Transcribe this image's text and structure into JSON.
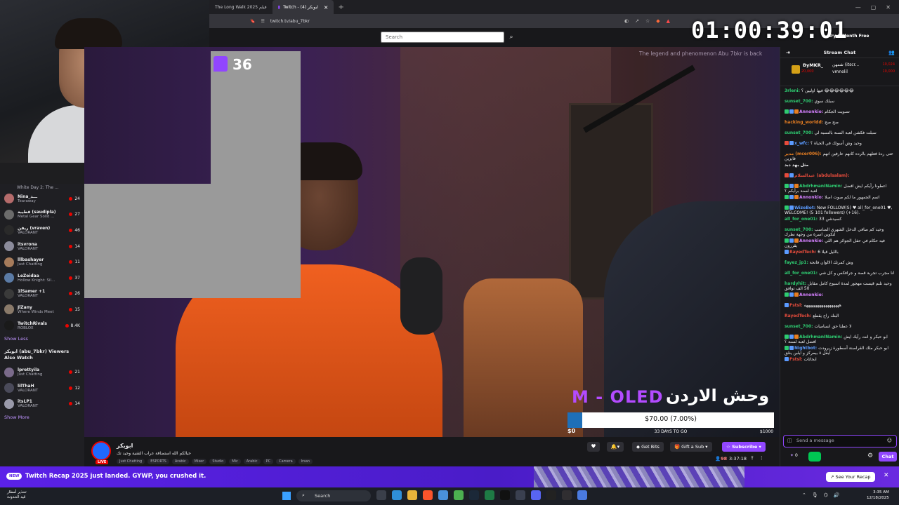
{
  "browser": {
    "tabs": [
      {
        "label": "The Long Walk 2025 فيلم",
        "active": false
      },
      {
        "label": "Twitch - ابوبكر (4)",
        "active": true
      }
    ],
    "url": "twitch.tv/abu_7bkr"
  },
  "topnav": {
    "search_placeholder": "Search",
    "try_turbo": "Try 1-Month Free"
  },
  "overlay": {
    "clock": "01:00:39:01",
    "bits_count": "36",
    "video_caption": "The legend and phenomenon Abu 7bkr is back",
    "oled_text": "M - OLED",
    "arabic_title": "وحش الاردن",
    "goal": {
      "amount": "$70.00 (7.00%)",
      "fraction": 0.07,
      "days": "33 DAYS TO GO",
      "min": "$0",
      "max": "$1000"
    }
  },
  "sidebar": {
    "partial_item": "White Day 2: The ...",
    "channels": [
      {
        "name": "Nina_ـــد",
        "game": "Tearaway",
        "viewers": "24",
        "color": "#b56b6b"
      },
      {
        "name": "قطيبة (saudipla)",
        "game": "Metal Gear Solid ...",
        "viewers": "27",
        "color": "#6b6b6b"
      },
      {
        "name": "ريفن (vraven)",
        "game": "VALORANT",
        "viewers": "46",
        "color": "#2a2a2a"
      },
      {
        "name": "itsvrona",
        "game": "VALORANT",
        "viewers": "14",
        "color": "#8b8b9b"
      },
      {
        "name": "lllbashayer",
        "game": "Just Chatting",
        "viewers": "11",
        "color": "#a67b5b"
      },
      {
        "name": "LeZeidaa",
        "game": "Hollow Knight: Sil...",
        "viewers": "37",
        "color": "#5b7ba6"
      },
      {
        "name": "1lSamer +1",
        "game": "VALORANT",
        "viewers": "26",
        "color": "#3a3a3a"
      },
      {
        "name": "JlZany",
        "game": "Where Winds Meet",
        "viewers": "15",
        "color": "#8a7a6a"
      },
      {
        "name": "TwitchRivals",
        "game": "ROBLOX",
        "viewers": "8.4K",
        "color": "#1a1a1a"
      }
    ],
    "show_less": "Show Less",
    "also_watch_heading": "ابوبكر (abu_7bkr) Viewers Also Watch",
    "also_watch": [
      {
        "name": "lprettyila",
        "game": "Just Chatting",
        "viewers": "21",
        "color": "#7a6a8a"
      },
      {
        "name": "lilThaH",
        "game": "VALORANT",
        "viewers": "12",
        "color": "#4a4a5a"
      },
      {
        "name": "itsLP1",
        "game": "VALORANT",
        "viewers": "14",
        "color": "#9a9aaa"
      }
    ],
    "show_more": "Show More"
  },
  "channel": {
    "name": "ابوبكر",
    "live": "LIVE",
    "title": "حيالكم الله استضافة عراب التقنية وحيد تك",
    "tags": [
      "Just Chatting",
      "ESPORTS",
      "Arabic",
      "Mixer",
      "Studio",
      "Mic",
      "Arabic",
      "PC",
      "Camera",
      "Irsan"
    ],
    "get_bits": "Get Bits",
    "gift_sub": "Gift a Sub",
    "subscribe": "Subscribe",
    "viewers": "98",
    "uptime": "3:37:18"
  },
  "chat": {
    "header": "Stream Chat",
    "pinned": {
      "name": "ByMKR_",
      "amount_left": "20,000",
      "right1": "شمهن (itscr...",
      "right2": "vmnolil",
      "amount_right1": "10,024",
      "amount_right2": "10,000"
    },
    "messages": [
      {
        "user": "3rleni:",
        "text": "😂😂😂😂😂😂 فيها اوليين ؟",
        "color": "#2ecc71",
        "badges": []
      },
      {
        "user": "sunset_700:",
        "text": "سبلك سوي",
        "color": "#2ecc71",
        "badges": []
      },
      {
        "user": "Annonkio:",
        "text": "تصويت الجكام",
        "color": "#d580ff",
        "badges": [
          "#2ecc71",
          "#5b9bff",
          "#e67e22"
        ]
      },
      {
        "user": "hacking_worldd:",
        "text": "صح صح",
        "color": "#e67e22",
        "badges": []
      },
      {
        "user": "sunset_700:",
        "text": "سبلت فكشن لعبة السنة بالنسبة لي",
        "color": "#2ecc71",
        "badges": []
      },
      {
        "user": "x_wfc:",
        "text": "وحيد وش أسوئك في الحياة ؟",
        "color": "#5b9bff",
        "badges": [
          "#e74c3c",
          "#5b9bff"
        ]
      },
      {
        "user": "مدير (mcer006):",
        "text": "حتى ردة فعلهم بالرده كانهم عارفين انهم فايزين",
        "color": "#e67e22",
        "badges": []
      },
      {
        "user": "مثل بهد دبد",
        "text": "",
        "color": "#efeff1",
        "badges": []
      },
      {
        "user": "عبدالسلام (abdulsalam):",
        "text": "",
        "color": "#e74c3c",
        "badges": [
          "#e74c3c",
          "#5b9bff"
        ]
      },
      {
        "user": "AbdrhmanINamin:",
        "text": "اعطونا رأيكم ايش افضل لعبة لسنة برأيكم ؟",
        "color": "#2ecc71",
        "badges": [
          "#2ecc71",
          "#5b9bff",
          "#e67e22"
        ]
      },
      {
        "user": "Annonkio:",
        "text": "اتمم الجمهور ما لكم صوت اصلا",
        "color": "#d580ff",
        "badges": [
          "#2ecc71",
          "#5b9bff",
          "#e67e22"
        ]
      },
      {
        "user": "WizeBot:",
        "text": "New FOLLOW(S) ♥ all_for_one01 ♥, WELCOME! (5 101 followers) (+16).",
        "color": "#5b9bff",
        "badges": [
          "#2ecc71",
          "#5b9bff"
        ]
      },
      {
        "user": "all_for_one01:",
        "text": "كسيدشن 33",
        "color": "#2ecc71",
        "badges": []
      },
      {
        "user": "sunset_700:",
        "text": "وحيد كم صافي الدخل الشهري المناسب لتكوين اسرة من وجهة نظرك",
        "color": "#2ecc71",
        "badges": []
      },
      {
        "user": "Annonkio:",
        "text": "فيه حكام في حفل الجوائز هم اللي يقررون",
        "color": "#d580ff",
        "badges": [
          "#2ecc71",
          "#5b9bff",
          "#e67e22"
        ]
      },
      {
        "user": "RayedTech:",
        "text": "بالليل قيلا 6",
        "color": "#e74c3c",
        "badges": [
          "#5b9bff"
        ]
      },
      {
        "user": "fayez_jp1:",
        "text": "وش كمرتك الالوان فاتحة",
        "color": "#2ecc71",
        "badges": []
      },
      {
        "user": "all_for_one01:",
        "text": "انا مجرب تجربة قصة و جرافكس و كل شي",
        "color": "#2ecc71",
        "badges": []
      },
      {
        "user": "hardyhit:",
        "text": "وحيد تلنم قيست مهجور لمدة اسبوع كامل مقابل 50 الف توافق",
        "color": "#2ecc71",
        "badges": []
      },
      {
        "user": "Annonkio:",
        "text": "",
        "color": "#d580ff",
        "badges": [
          "#2ecc71",
          "#5b9bff",
          "#e67e22"
        ]
      },
      {
        "user": "Fstsl:",
        "text": "ههههههههههههههههههه",
        "color": "#e74c3c",
        "badges": [
          "#5b9bff"
        ]
      },
      {
        "user": "RayedTech:",
        "text": "البنك راح يقطع",
        "color": "#e74c3c",
        "badges": []
      },
      {
        "user": "sunset_700:",
        "text": "لا عطنا حق انساميات",
        "color": "#2ecc71",
        "badges": []
      },
      {
        "user": "AbdrhmanINamin:",
        "text": "ابو حبكر و انت رأيك ايش افضل لعبة لسنة ؟",
        "color": "#2ecc71",
        "badges": [
          "#2ecc71",
          "#5b9bff",
          "#e67e22"
        ]
      },
      {
        "user": "Nightbot:",
        "text": "ابو حبكر ملك القراصنة أسطورة زيرودت ايقل ٨ بيمركز و ايلبن ينلق",
        "color": "#5b9bff",
        "badges": [
          "#2ecc71",
          "#5b9bff"
        ]
      },
      {
        "user": "Fstsl:",
        "text": "ابحاثات",
        "color": "#e74c3c",
        "badges": [
          "#5b9bff"
        ]
      }
    ],
    "input_placeholder": "Send a message",
    "points": "0",
    "chat_button": "Chat"
  },
  "recap": {
    "badge": "NEW",
    "text": "Twitch Recap 2025 just landed. GYWP, you crushed it.",
    "button": "See Your Recap"
  },
  "taskbar": {
    "weather_line1": "تحذير أمطار",
    "weather_line2": "قيد الحدوث",
    "search": "Search",
    "time": "3:35 AM",
    "date": "12/18/2025"
  }
}
